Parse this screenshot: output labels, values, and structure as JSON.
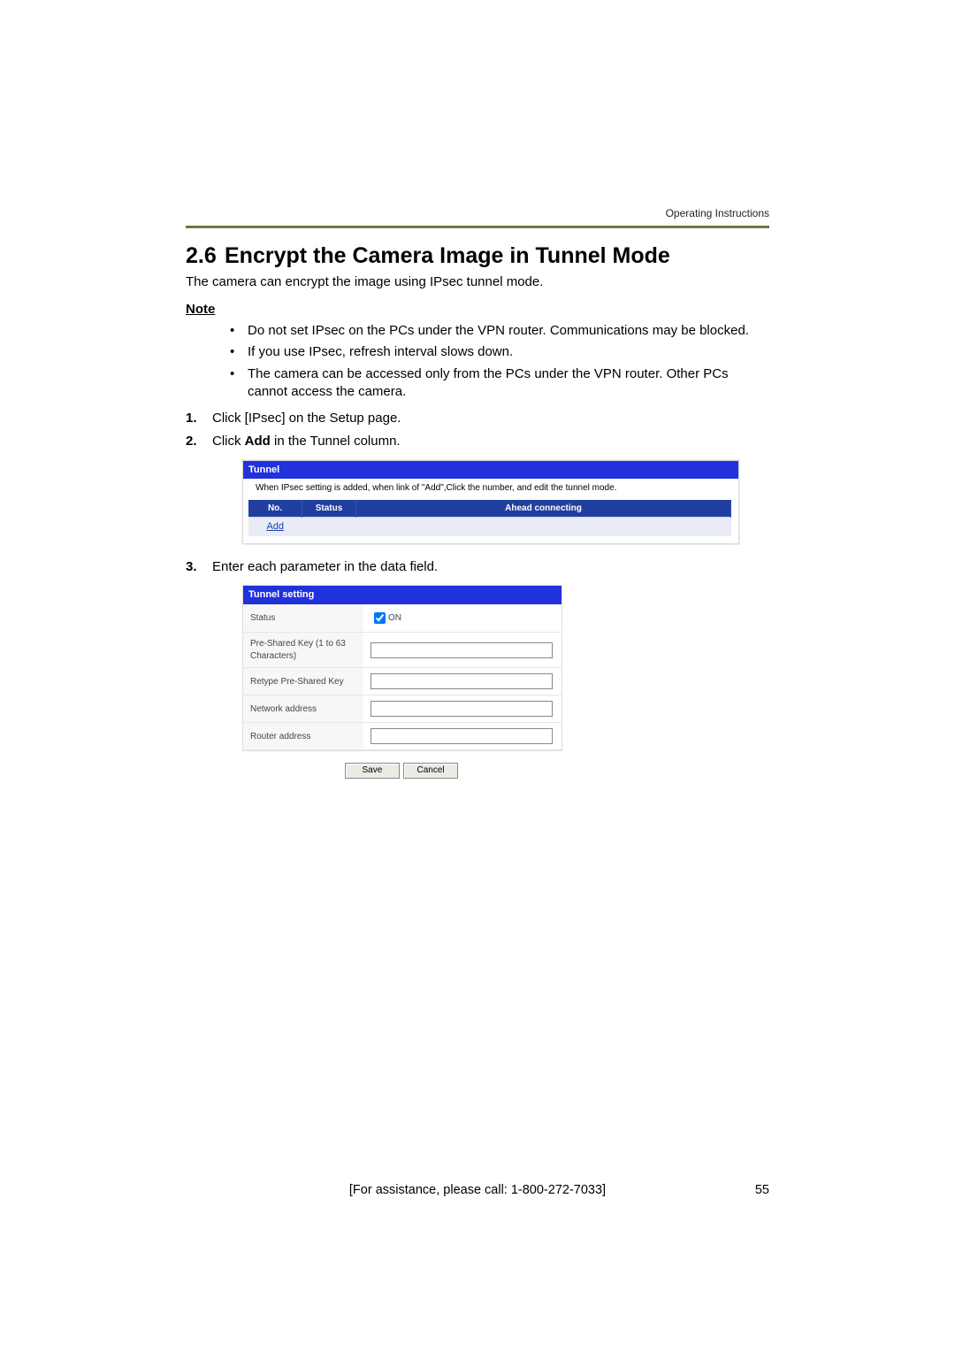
{
  "running_head": "Operating Instructions",
  "section_number": "2.6",
  "section_title": "Encrypt the Camera Image in Tunnel Mode",
  "intro": "The camera can encrypt the image using IPsec tunnel mode.",
  "note_label": "Note",
  "notes": [
    "Do not set IPsec on the PCs under the VPN router. Communications may be blocked.",
    "If you use IPsec, refresh interval slows down.",
    "The camera can be accessed only from the PCs under the VPN router. Other PCs cannot access the camera."
  ],
  "steps": {
    "s1": {
      "num": "1.",
      "text": "Click [IPsec] on the Setup page."
    },
    "s2": {
      "num": "2.",
      "prefix": "Click ",
      "bold": "Add",
      "suffix": " in the Tunnel column."
    },
    "s3": {
      "num": "3.",
      "text": "Enter each parameter in the data field."
    }
  },
  "tunnel": {
    "header": "Tunnel",
    "note": "When IPsec setting is added, when link of \"Add\",Click the number, and edit the tunnel mode.",
    "cols": {
      "no": "No.",
      "status": "Status",
      "ahead": "Ahead connecting"
    },
    "row": {
      "add": "Add"
    }
  },
  "setting": {
    "header": "Tunnel setting",
    "rows": {
      "status": {
        "label": "Status",
        "check_label": "ON",
        "checked": true
      },
      "psk": {
        "label": "Pre-Shared Key (1 to 63 Characters)"
      },
      "repsk": {
        "label": "Retype Pre-Shared Key"
      },
      "netaddr": {
        "label": "Network address"
      },
      "raddr": {
        "label": "Router address"
      }
    },
    "buttons": {
      "save": "Save",
      "cancel": "Cancel"
    }
  },
  "footer": {
    "assist": "[For assistance, please call: 1-800-272-7033]",
    "page": "55"
  }
}
